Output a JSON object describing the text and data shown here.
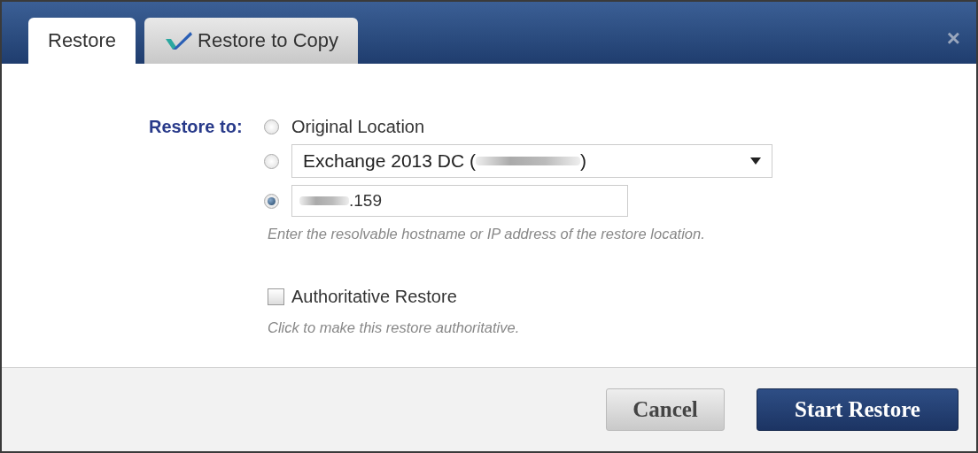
{
  "tabs": [
    {
      "label": "Restore",
      "selected": true,
      "kind": "plain"
    },
    {
      "label": "Restore to Copy",
      "selected": false,
      "kind": "icon"
    }
  ],
  "close": "×",
  "restore_to": {
    "label": "Restore to:",
    "options": [
      {
        "kind": "label",
        "text": "Original Location",
        "selected": false
      },
      {
        "kind": "select",
        "prefix": "Exchange 2013 DC (",
        "suffix": ")",
        "selected": false
      },
      {
        "kind": "input",
        "value": ".159",
        "selected": true
      }
    ]
  },
  "hint": "Enter the resolvable hostname or IP address of the restore location.",
  "authoritative": {
    "label": "Authoritative Restore",
    "checked": false,
    "hint": "Click to make this restore authoritative."
  },
  "buttons": [
    {
      "label": "Cancel",
      "kind": "secondary"
    },
    {
      "label": "Start Restore",
      "kind": "primary"
    }
  ]
}
